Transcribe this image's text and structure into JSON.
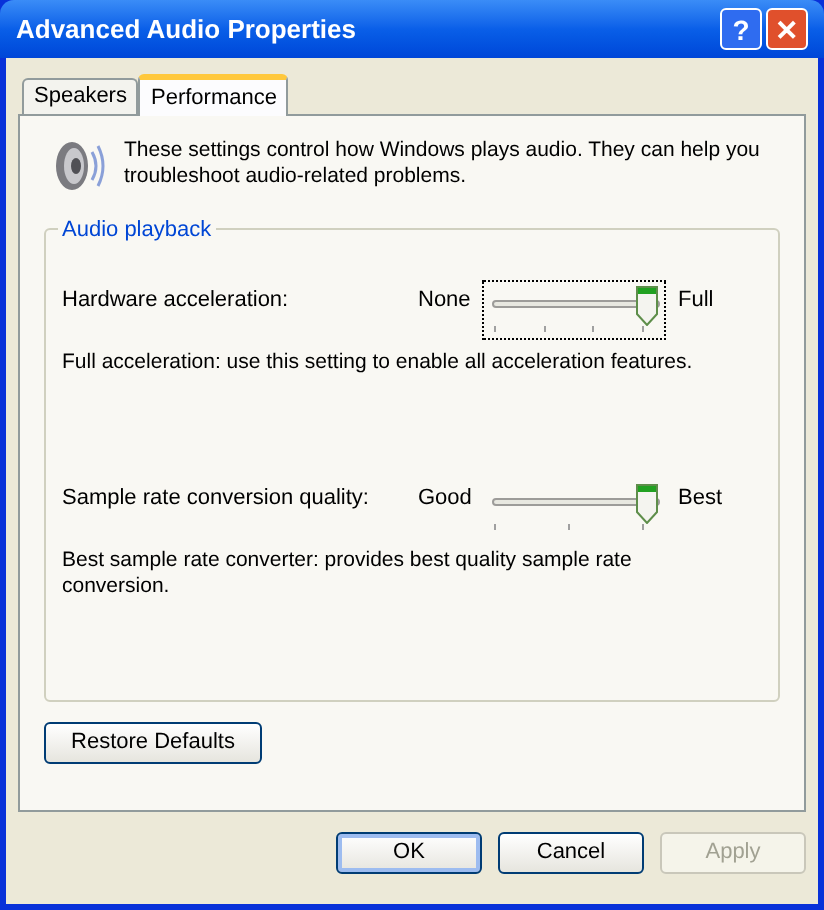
{
  "window": {
    "title": "Advanced Audio Properties",
    "title_buttons": [
      {
        "kind": "help",
        "label": "?"
      },
      {
        "kind": "close",
        "label": "✕"
      }
    ]
  },
  "tabs": [
    {
      "label": "Speakers",
      "selected": false
    },
    {
      "label": "Performance",
      "selected": true
    }
  ],
  "intro": "These settings control how Windows plays audio. They can help you troubleshoot audio-related problems.",
  "group": {
    "title": "Audio playback",
    "settings": [
      {
        "label": "Hardware acceleration:",
        "min_label": "None",
        "max_label": "Full",
        "level": 1,
        "focused": true,
        "description": "Full acceleration: use this setting to enable all acceleration features."
      },
      {
        "label": "Sample rate conversion quality:",
        "min_label": "Good",
        "max_label": "Best",
        "level": 1,
        "focused": false,
        "description": "Best sample rate converter:  provides best quality sample rate conversion."
      }
    ]
  },
  "restore_button": "Restore Defaults",
  "buttons": [
    {
      "label": "OK",
      "disabled": false,
      "default": true
    },
    {
      "label": "Cancel",
      "disabled": false,
      "default": false
    },
    {
      "label": "Apply",
      "disabled": true,
      "default": false
    }
  ]
}
